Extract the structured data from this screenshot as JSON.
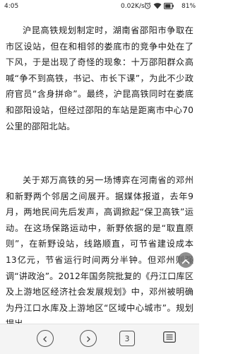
{
  "status_bar": {
    "time": "4:05",
    "network_speed": "0.02K/s",
    "battery_percent": "81%",
    "icons": [
      "alarm-icon",
      "wifi-icon",
      "battery-icon"
    ]
  },
  "article": {
    "paragraphs": [
      "沪昆高铁规划制定时，湖南省邵阳市争取在市区设站，但在和相邻的娄底市的竞争中处在了下风，于是出现了奇怪的现象：十万邵阳群众高喊“争不到高铁，书记、市长下课”，为此不少政府官员“含身拼命”。最终，沪昆高铁同时在娄底和邵阳设站，但经过邵阳的车站是距离市中心70公里的邵阳北站。",
      "关于郑万高铁的另一场博弈在河南省的邓州和新野两个邻居之间展开。据媒体报道，去年9月，两地民间先后发声，高调掀起“保卫高铁”运动。在这场保路运动中，新野依据的是“取直原则”，在新野设站，线路顺直，可节省建设成本13亿元，节省运行时间两分半钟。但邓州则强调“讲政治”。2012年国务院批复的《丹江口库区及上游地区经济社会发展规划》中，邓州被明确为丹江口水库及上游地区“区域中心城市”。规划提出"
    ]
  },
  "bottom_bar": {
    "tab_count": "3",
    "icons": [
      "back-icon",
      "forward-icon",
      "tabs-icon",
      "menu-icon"
    ]
  },
  "scroll_up": {
    "icon": "chevron-up-icon"
  }
}
